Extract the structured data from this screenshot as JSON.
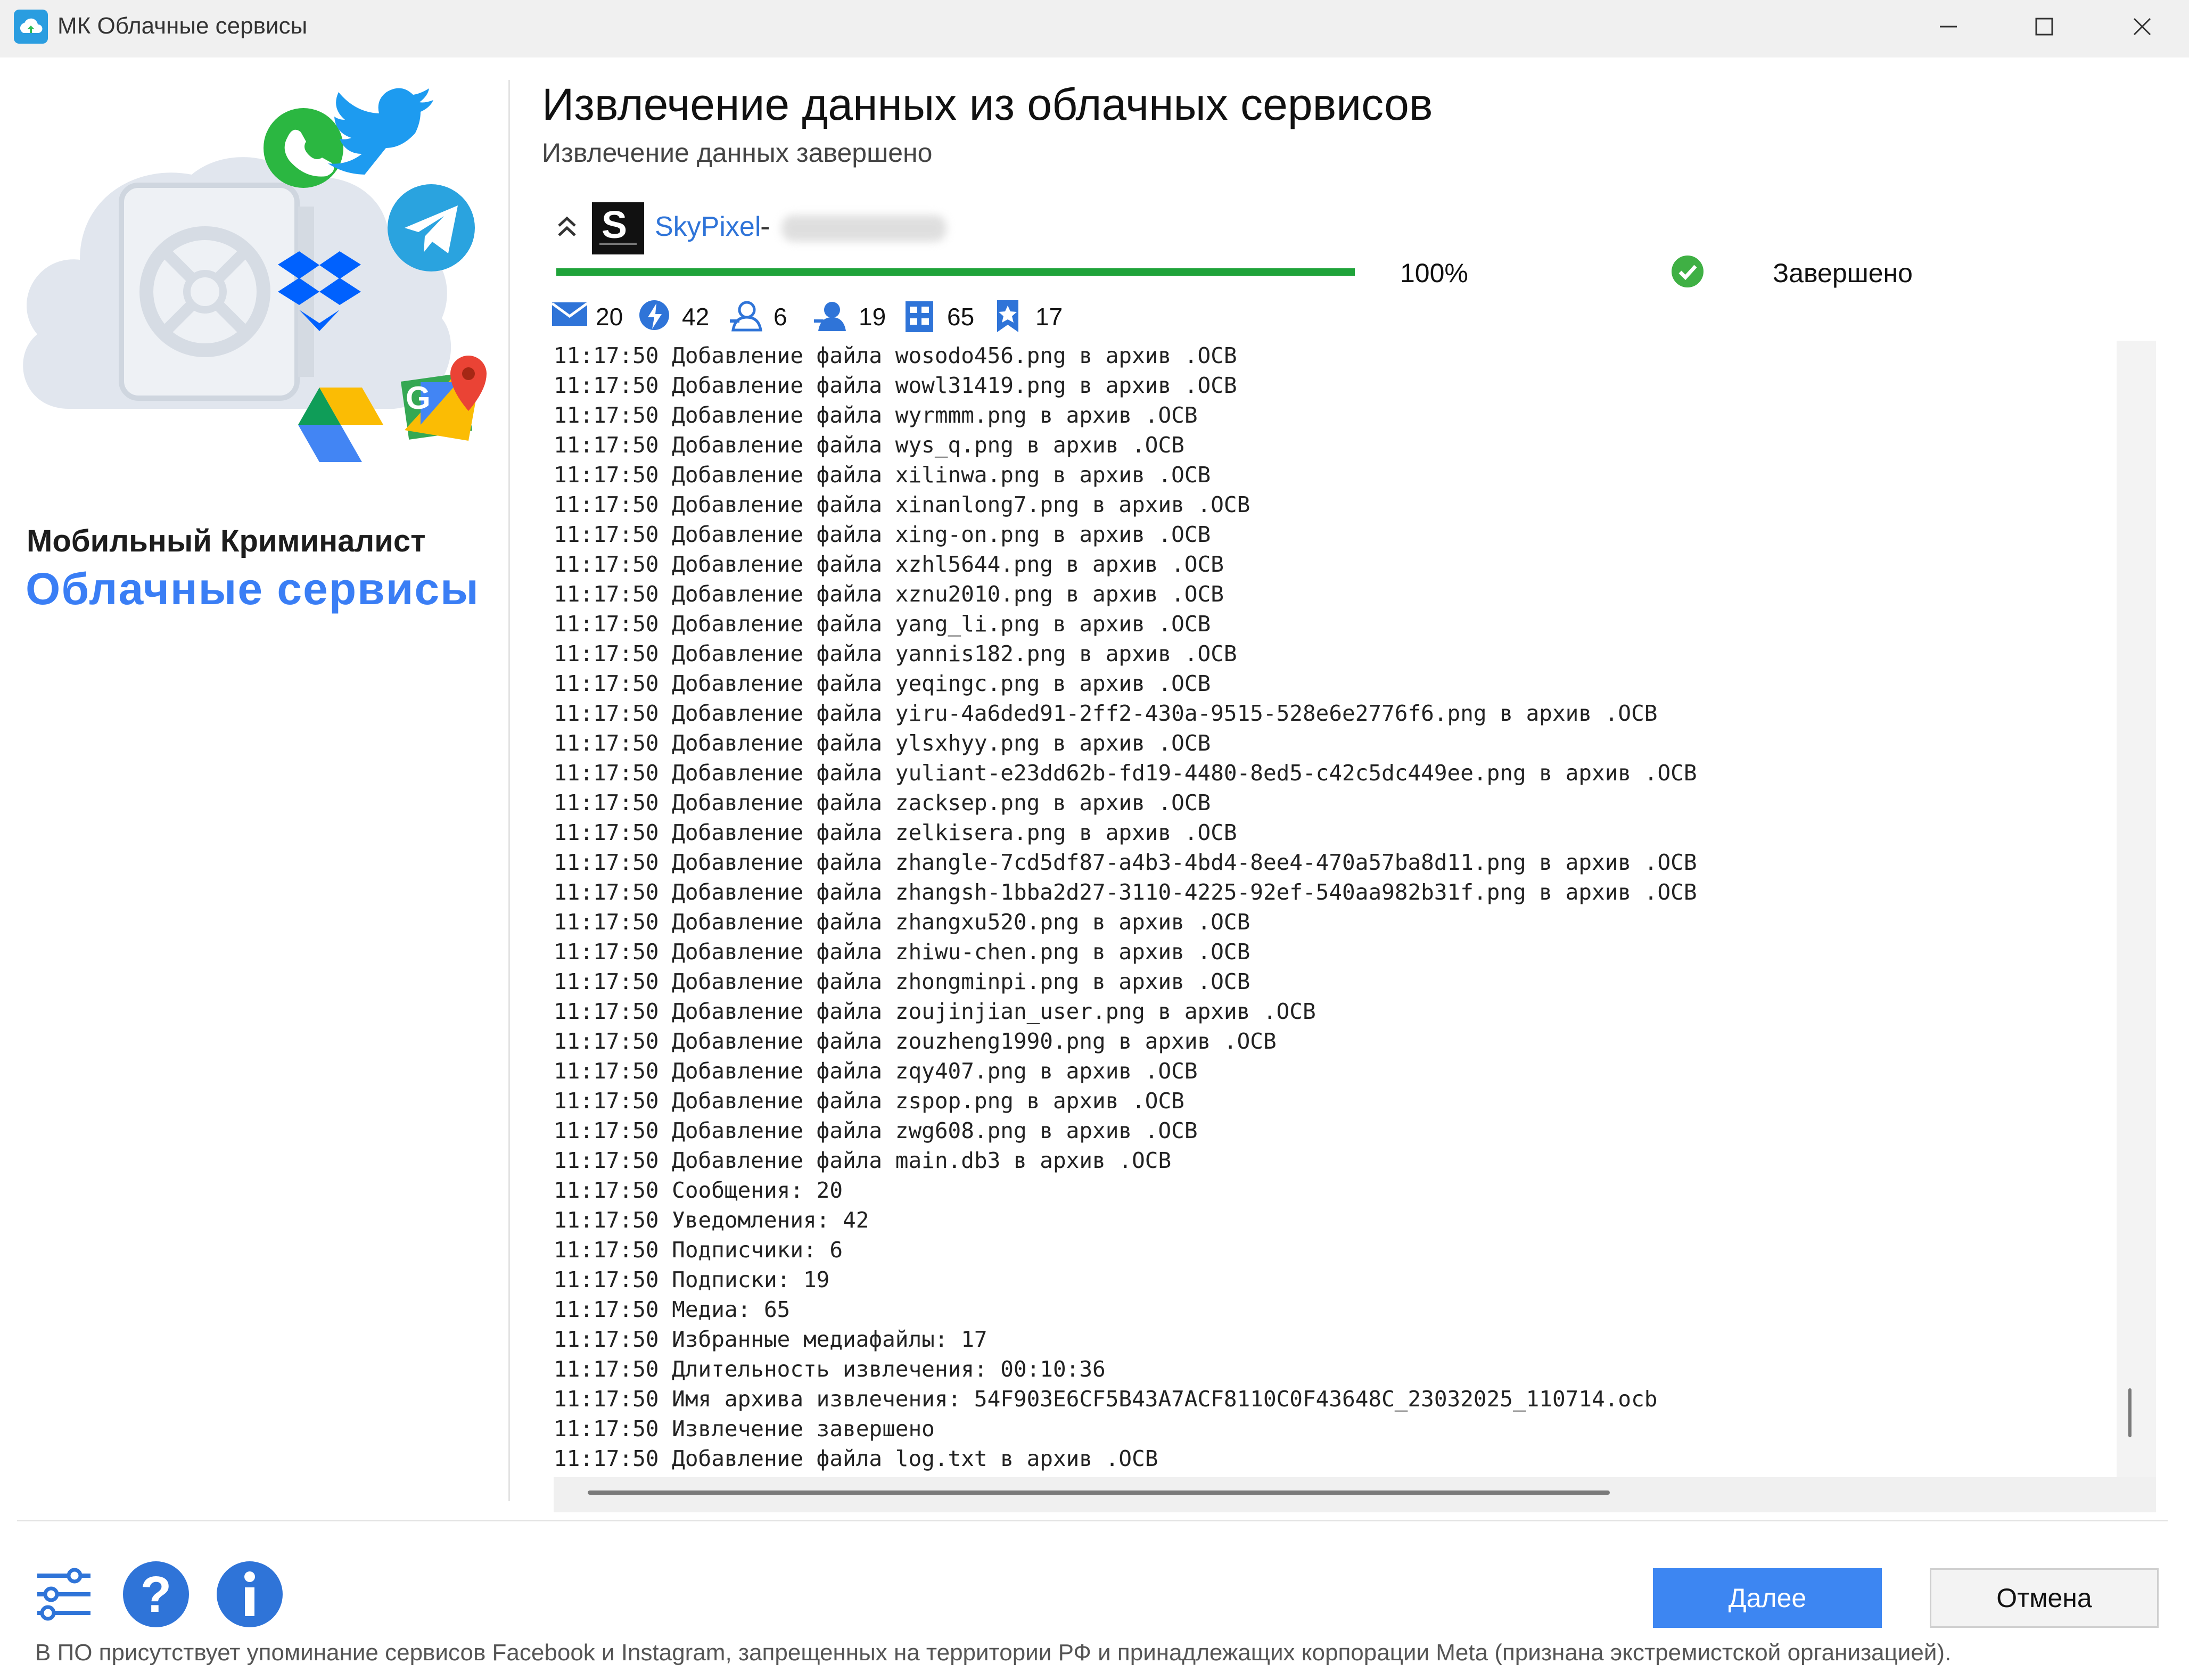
{
  "window": {
    "title": "МК Облачные сервисы"
  },
  "brand": {
    "line1": "Мобильный Криминалист",
    "line2": "Облачные сервисы"
  },
  "header": {
    "title": "Извлечение данных из облачных сервисов",
    "subtitle": "Извлечение данных завершено"
  },
  "source": {
    "logo_letter": "S",
    "name": "SkyPixel",
    "separator": "-",
    "progress": 100,
    "progress_text": "100%",
    "status": "Завершено"
  },
  "stats": [
    {
      "icon": "message-icon",
      "value": "20"
    },
    {
      "icon": "notification-icon",
      "value": "42"
    },
    {
      "icon": "followers-icon",
      "value": "6"
    },
    {
      "icon": "subscriptions-icon",
      "value": "19"
    },
    {
      "icon": "media-icon",
      "value": "65"
    },
    {
      "icon": "favorites-icon",
      "value": "17"
    }
  ],
  "log": [
    "11:17:50 Добавление файла wosodo456.png в архив .OCB",
    "11:17:50 Добавление файла wowl31419.png в архив .OCB",
    "11:17:50 Добавление файла wyrmmm.png в архив .OCB",
    "11:17:50 Добавление файла wys_q.png в архив .OCB",
    "11:17:50 Добавление файла xilinwa.png в архив .OCB",
    "11:17:50 Добавление файла xinanlong7.png в архив .OCB",
    "11:17:50 Добавление файла xing-on.png в архив .OCB",
    "11:17:50 Добавление файла xzhl5644.png в архив .OCB",
    "11:17:50 Добавление файла xznu2010.png в архив .OCB",
    "11:17:50 Добавление файла yang_li.png в архив .OCB",
    "11:17:50 Добавление файла yannis182.png в архив .OCB",
    "11:17:50 Добавление файла yeqingc.png в архив .OCB",
    "11:17:50 Добавление файла yiru-4a6ded91-2ff2-430a-9515-528e6e2776f6.png в архив .OCB",
    "11:17:50 Добавление файла ylsxhyy.png в архив .OCB",
    "11:17:50 Добавление файла yuliant-e23dd62b-fd19-4480-8ed5-c42c5dc449ee.png в архив .OCB",
    "11:17:50 Добавление файла zacksep.png в архив .OCB",
    "11:17:50 Добавление файла zelkisera.png в архив .OCB",
    "11:17:50 Добавление файла zhangle-7cd5df87-a4b3-4bd4-8ee4-470a57ba8d11.png в архив .OCB",
    "11:17:50 Добавление файла zhangsh-1bba2d27-3110-4225-92ef-540aa982b31f.png в архив .OCB",
    "11:17:50 Добавление файла zhangxu520.png в архив .OCB",
    "11:17:50 Добавление файла zhiwu-chen.png в архив .OCB",
    "11:17:50 Добавление файла zhongminpi.png в архив .OCB",
    "11:17:50 Добавление файла zoujinjian_user.png в архив .OCB",
    "11:17:50 Добавление файла zouzheng1990.png в архив .OCB",
    "11:17:50 Добавление файла zqy407.png в архив .OCB",
    "11:17:50 Добавление файла zspop.png в архив .OCB",
    "11:17:50 Добавление файла zwg608.png в архив .OCB",
    "11:17:50 Добавление файла main.db3 в архив .OCB",
    "11:17:50 Сообщения: 20",
    "11:17:50 Уведомления: 42",
    "11:17:50 Подписчики: 6",
    "11:17:50 Подписки: 19",
    "11:17:50 Медиа: 65",
    "11:17:50 Избранные медиафайлы: 17",
    "11:17:50 Длительность извлечения: 00:10:36",
    "11:17:50 Имя архива извлечения: 54F903E6CF5B43A7ACF8110C0F43648C_23032025_110714.ocb",
    "11:17:50 Извлечение завершено",
    "11:17:50 Добавление файла log.txt в архив .OCB"
  ],
  "buttons": {
    "next": "Далее",
    "cancel": "Отмена"
  },
  "footer": {
    "note": "В ПО присутствует упоминание сервисов Facebook и Instagram, запрещенных на территории РФ и принадлежащих корпорации Meta (признана экстремистской организацией)."
  },
  "colors": {
    "accent": "#3d86f2",
    "progress": "#1fa33a",
    "link": "#2f74d8"
  }
}
